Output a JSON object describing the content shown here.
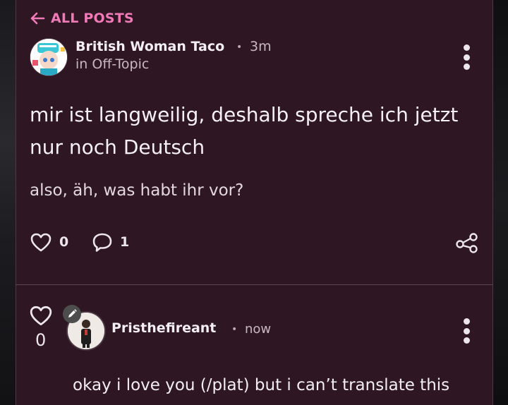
{
  "nav": {
    "back_label": "ALL POSTS"
  },
  "post": {
    "author": "British Woman Taco",
    "separator": "•",
    "time": "3m",
    "community": "in Off-Topic",
    "title": "mir ist langweilig, deshalb spreche ich jetzt nur noch Deutsch",
    "body": "also, äh, was habt ihr vor?",
    "likes": "0",
    "comments": "1"
  },
  "reply": {
    "votes": "0",
    "author": "Pristhefireant",
    "separator": "•",
    "time": "now",
    "text": "okay i love you (/plat) but i can’t translate this"
  },
  "colors": {
    "panel_bg": "#2e1622",
    "accent_pink": "#f07ab8",
    "text_primary": "#f3eef1",
    "text_secondary": "#c8b8c0"
  },
  "icons": [
    "arrow-left-icon",
    "kebab-menu-icon",
    "heart-icon",
    "comment-icon",
    "share-icon",
    "pencil-icon"
  ]
}
